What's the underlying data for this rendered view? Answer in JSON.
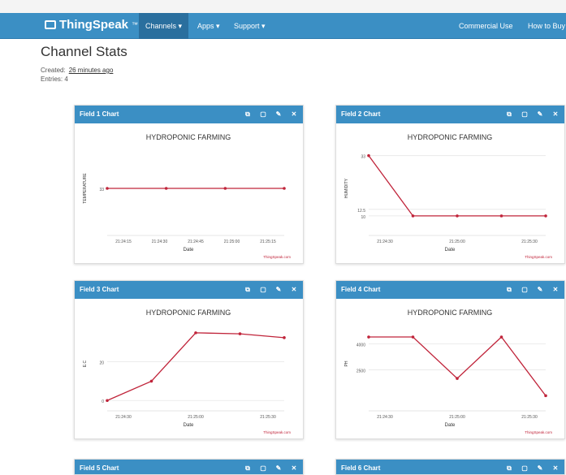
{
  "navbar": {
    "brand": "ThingSpeak",
    "brand_tm": "™",
    "items": [
      {
        "label": "Channels ▾"
      },
      {
        "label": "Apps ▾"
      },
      {
        "label": "Support ▾"
      }
    ],
    "right": [
      {
        "label": "Commercial Use"
      },
      {
        "label": "How to Buy"
      }
    ]
  },
  "page": {
    "title": "Channel Stats",
    "created_label": "Created:",
    "created_value": "26 minutes ago",
    "entries_label": "Entries:",
    "entries_value": "4"
  },
  "colors": {
    "accent": "#3b8fc4",
    "line": "#c0243a"
  },
  "icons": [
    "external-link-icon",
    "comment-icon",
    "pencil-icon",
    "close-icon"
  ],
  "charts": [
    {
      "header": "Field 1 Chart",
      "chart_data": {
        "type": "line",
        "title": "HYDROPONIC FARMING",
        "xlabel": "Date",
        "ylabel": "TEMPERATURE",
        "credit": "ThingSpeak.com",
        "x": [
          "21:24:15",
          "21:24:30",
          "21:24:45",
          "21:25:00",
          "21:25:15"
        ],
        "points": [
          0,
          1,
          2,
          3
        ],
        "yticks": [
          "33"
        ],
        "values": [
          33,
          33,
          33,
          33
        ]
      }
    },
    {
      "header": "Field 2 Chart",
      "chart_data": {
        "type": "line",
        "title": "HYDROPONIC FARMING",
        "xlabel": "Date",
        "ylabel": "HUMIDITY",
        "credit": "ThingSpeak.com",
        "x": [
          "21:24:30",
          "21:25:00",
          "21:25:30"
        ],
        "yticks": [
          "33",
          "12.5",
          "10"
        ],
        "values": [
          33,
          10,
          10,
          10,
          10
        ]
      }
    },
    {
      "header": "Field 3 Chart",
      "chart_data": {
        "type": "line",
        "title": "HYDROPONIC FARMING",
        "xlabel": "Date",
        "ylabel": "E.C",
        "credit": "ThingSpeak.com",
        "x": [
          "21:24:30",
          "21:25:00",
          "21:25:30"
        ],
        "yticks": [
          "20",
          "0"
        ],
        "values": [
          0,
          10,
          35,
          34.5,
          32.5
        ]
      }
    },
    {
      "header": "Field 4 Chart",
      "chart_data": {
        "type": "line",
        "title": "HYDROPONIC FARMING",
        "xlabel": "Date",
        "ylabel": "PH",
        "credit": "ThingSpeak.com",
        "x": [
          "21:24:30",
          "21:25:00",
          "21:25:30"
        ],
        "yticks": [
          "4000",
          "2500"
        ],
        "values": [
          4400,
          4400,
          2000,
          4400,
          1000
        ]
      }
    }
  ],
  "partial_headers": [
    "Field 5 Chart",
    "Field 6 Chart"
  ]
}
